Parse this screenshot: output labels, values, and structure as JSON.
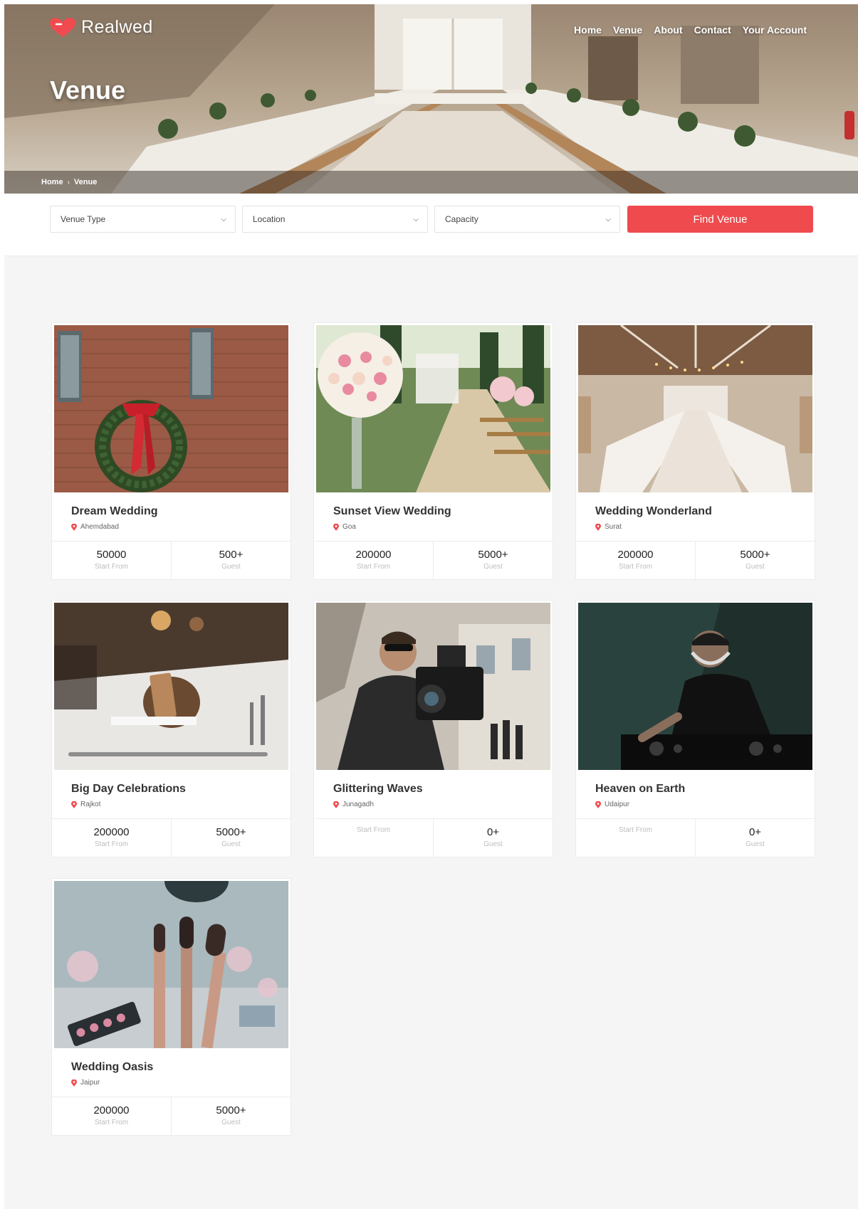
{
  "brand": {
    "name": "Realwed",
    "accent": "#ef4b4f"
  },
  "nav": [
    "Home",
    "Venue",
    "About",
    "Contact",
    "Your Account"
  ],
  "hero": {
    "title": "Venue"
  },
  "breadcrumb": [
    "Home",
    "Venue"
  ],
  "filters": {
    "venue_type": "Venue Type",
    "location": "Location",
    "capacity": "Capacity",
    "find_button": "Find Venue"
  },
  "venues": [
    {
      "name": "Dream Wedding",
      "location": "Ahemdabad",
      "price": "50000",
      "price_label": "Start From",
      "guests": "500+",
      "guests_label": "Guest",
      "image": "wreath-on-brick-wall"
    },
    {
      "name": "Sunset View Wedding",
      "location": "Goa",
      "price": "200000",
      "price_label": "Start From",
      "guests": "5000+",
      "guests_label": "Guest",
      "image": "garden-aisle-flowers"
    },
    {
      "name": "Wedding Wonderland",
      "location": "Surat",
      "price": "200000",
      "price_label": "Start From",
      "guests": "5000+",
      "guests_label": "Guest",
      "image": "banquet-hall"
    },
    {
      "name": "Big Day Celebrations",
      "location": "Rajkot",
      "price": "200000",
      "price_label": "Start From",
      "guests": "5000+",
      "guests_label": "Guest",
      "image": "bride-tag-table-setting"
    },
    {
      "name": "Glittering Waves",
      "location": "Junagadh",
      "price": "",
      "price_label": "Start From",
      "guests": "0+",
      "guests_label": "Guest",
      "image": "cameraman"
    },
    {
      "name": "Heaven on Earth",
      "location": "Udaipur",
      "price": "",
      "price_label": "Start From",
      "guests": "0+",
      "guests_label": "Guest",
      "image": "dj-at-decks"
    },
    {
      "name": "Wedding Oasis",
      "location": "Jaipur",
      "price": "200000",
      "price_label": "Start From",
      "guests": "5000+",
      "guests_label": "Guest",
      "image": "makeup-brushes"
    }
  ]
}
